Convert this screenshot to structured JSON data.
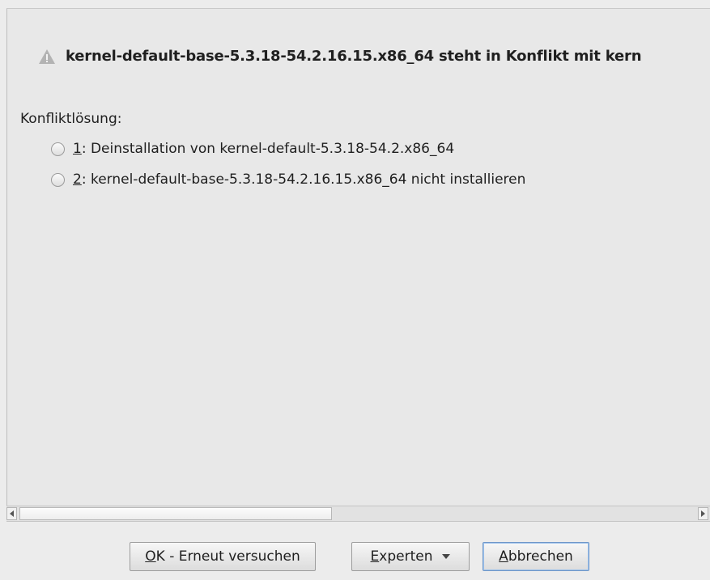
{
  "conflict": {
    "message": "kernel-default-base-5.3.18-54.2.16.15.x86_64 steht in Konflikt mit kern",
    "icon": "warning-icon"
  },
  "resolution": {
    "label": "Konfliktlösung:",
    "options": [
      {
        "number": "1",
        "text": ": Deinstallation von kernel-default-5.3.18-54.2.x86_64"
      },
      {
        "number": "2",
        "text": ": kernel-default-base-5.3.18-54.2.16.15.x86_64 nicht installieren"
      }
    ]
  },
  "scrollbar": {
    "left_icon": "scroll-left-arrow-icon",
    "right_icon": "scroll-right-arrow-icon"
  },
  "buttons": {
    "ok": {
      "mnemonic": "O",
      "rest": "K - Erneut versuchen"
    },
    "expert": {
      "mnemonic": "E",
      "rest": "xperten",
      "icon": "dropdown-arrow-icon"
    },
    "cancel": {
      "mnemonic": "A",
      "rest": "bbrechen"
    }
  },
  "colors": {
    "background": "#ececec",
    "focus_border": "#6f97c8",
    "warning_icon": "#a9a9a9"
  }
}
